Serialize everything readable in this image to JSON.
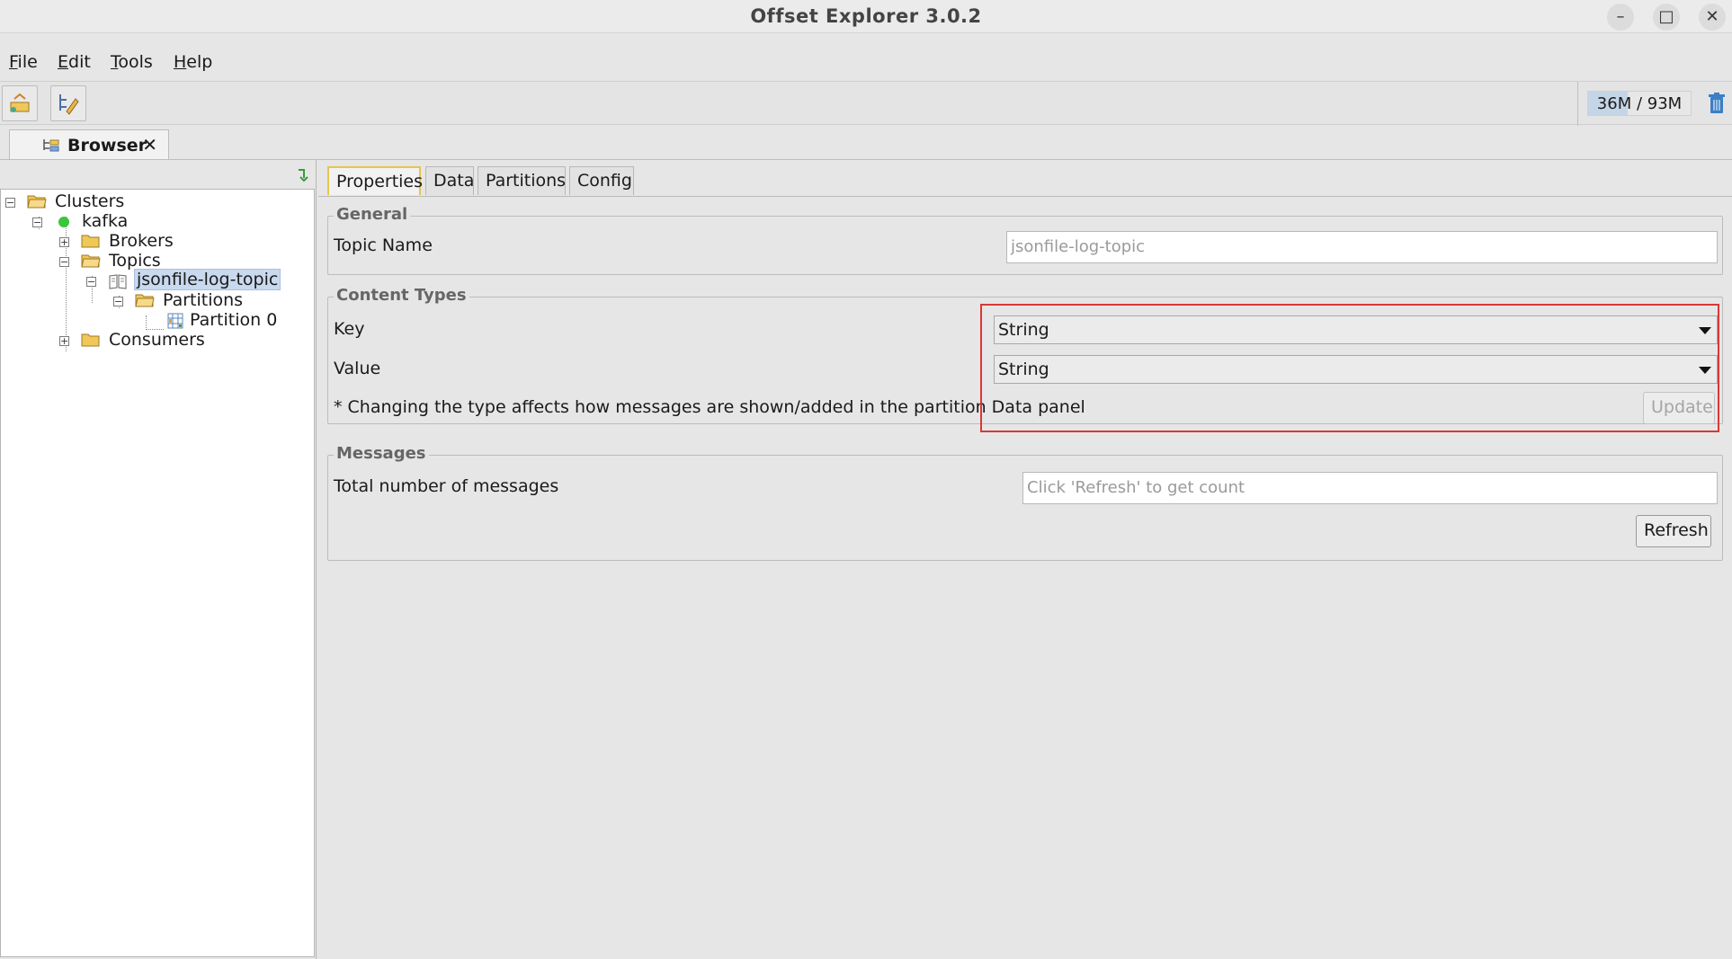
{
  "window": {
    "title": "Offset Explorer  3.0.2",
    "controls": [
      "minimize",
      "maximize",
      "close"
    ]
  },
  "menu": [
    "File",
    "Edit",
    "Tools",
    "Help"
  ],
  "toolbar": {
    "memory_label": "36M / 93M",
    "memory_used_fraction": 0.39
  },
  "doc_tab": {
    "label": "Browser",
    "close": "✕"
  },
  "tree": {
    "clusters": "Clusters",
    "kafka": "kafka",
    "brokers": "Brokers",
    "topics": "Topics",
    "topic": "jsonfile-log-topic",
    "partitions": "Partitions",
    "partition0": "Partition 0",
    "consumers": "Consumers"
  },
  "tabs": [
    "Properties",
    "Data",
    "Partitions",
    "Config"
  ],
  "general": {
    "title": "General",
    "topic_name_label": "Topic Name",
    "topic_name_value": "jsonfile-log-topic"
  },
  "content_types": {
    "title": "Content Types",
    "key_label": "Key",
    "key_value": "String",
    "value_label": "Value",
    "value_value": "String",
    "note": "* Changing the type affects how messages are shown/added in the partition Data panel",
    "update_button": "Update"
  },
  "messages": {
    "title": "Messages",
    "total_label": "Total number of messages",
    "total_placeholder": "Click 'Refresh' to get count",
    "refresh_button": "Refresh"
  },
  "colors": {
    "highlight": "#d83838",
    "selection": "#c9d9ee",
    "folder": "#f0c85a",
    "status_green": "#3cc43c"
  }
}
